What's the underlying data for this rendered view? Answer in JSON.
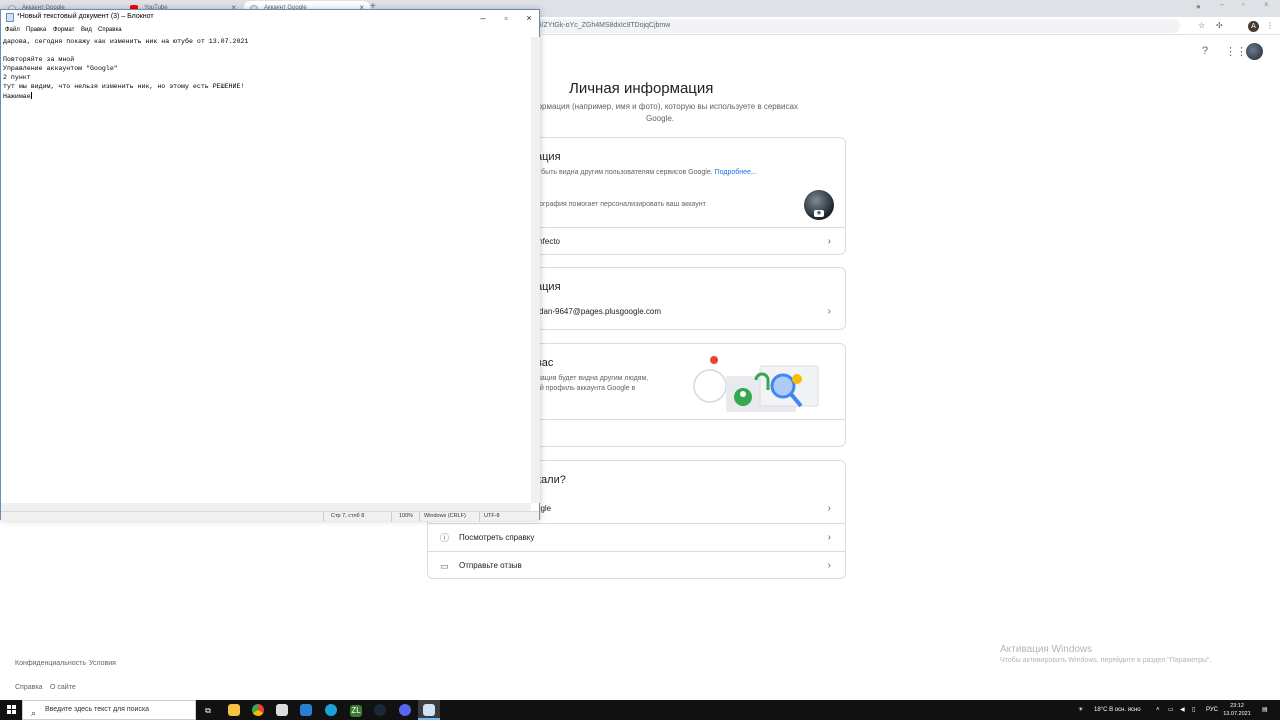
{
  "chrome": {
    "tabs": [
      {
        "label": "Аккаунт Google"
      },
      {
        "label": "YouTube"
      },
      {
        "label": "Аккаунт Google"
      }
    ],
    "address": "i/ZYtGk-oYc_ZGh4MS8dxIc9TDojqCjbmw",
    "profile_letter": "A"
  },
  "account": {
    "title": "Личная информация",
    "subtitle": "информация (например, имя и фото), которую вы используете в сервисах Google.",
    "card1": {
      "title": "ация",
      "desc": "т быть видна другим пользователям сервисов Google.",
      "more_link": "Подробнее...",
      "photo_text": "тография помогает персонализировать ваш аккаунт",
      "row": "mfecto"
    },
    "card2": {
      "title": "ация",
      "row": "dan-9647@pages.plusgoogle.com"
    },
    "card3": {
      "title": "вас",
      "desc1": "мация будет видна другим людям,",
      "desc2": "ой профиль аккаунта Google в"
    },
    "card4": {
      "title": "кали?",
      "rows": [
        {
          "label": "ogle"
        },
        {
          "label": "Посмотреть справку"
        },
        {
          "label": "Отправьте отзыв"
        }
      ]
    },
    "footer": {
      "privacy": "Конфиденциальность",
      "terms": "Условия",
      "help": "Справка",
      "about": "О сайте"
    }
  },
  "activation": {
    "line1": "Активация Windows",
    "line2": "Чтобы активировать Windows, перейдите в раздел \"Параметры\"."
  },
  "notepad": {
    "title": "*Новый текстовый документ (3) – Блокнот",
    "menu": [
      "Файл",
      "Правка",
      "Формат",
      "Вид",
      "Справка"
    ],
    "lines": [
      "дарова, сегодня покажу как изменить ник на ютубе от 13.07.2021",
      "",
      "Повторяйте за мной",
      "Управление аккаунтом \"Google\"",
      "2 пункт",
      "тут мы видим, что нельзя изменить ник, но этому есть РЕШЕНИЕ!",
      "Нажимае"
    ],
    "status": {
      "position": "Стр 7, стлб 8",
      "zoom": "100%",
      "eol": "Windows (CRLF)",
      "encoding": "UTF-8"
    }
  },
  "taskbar": {
    "search_placeholder": "Введите здесь текст для поиска",
    "weather": "18°C  В осн. ясно",
    "lang": "РУС",
    "time": "23:12",
    "date": "13.07.2021"
  }
}
